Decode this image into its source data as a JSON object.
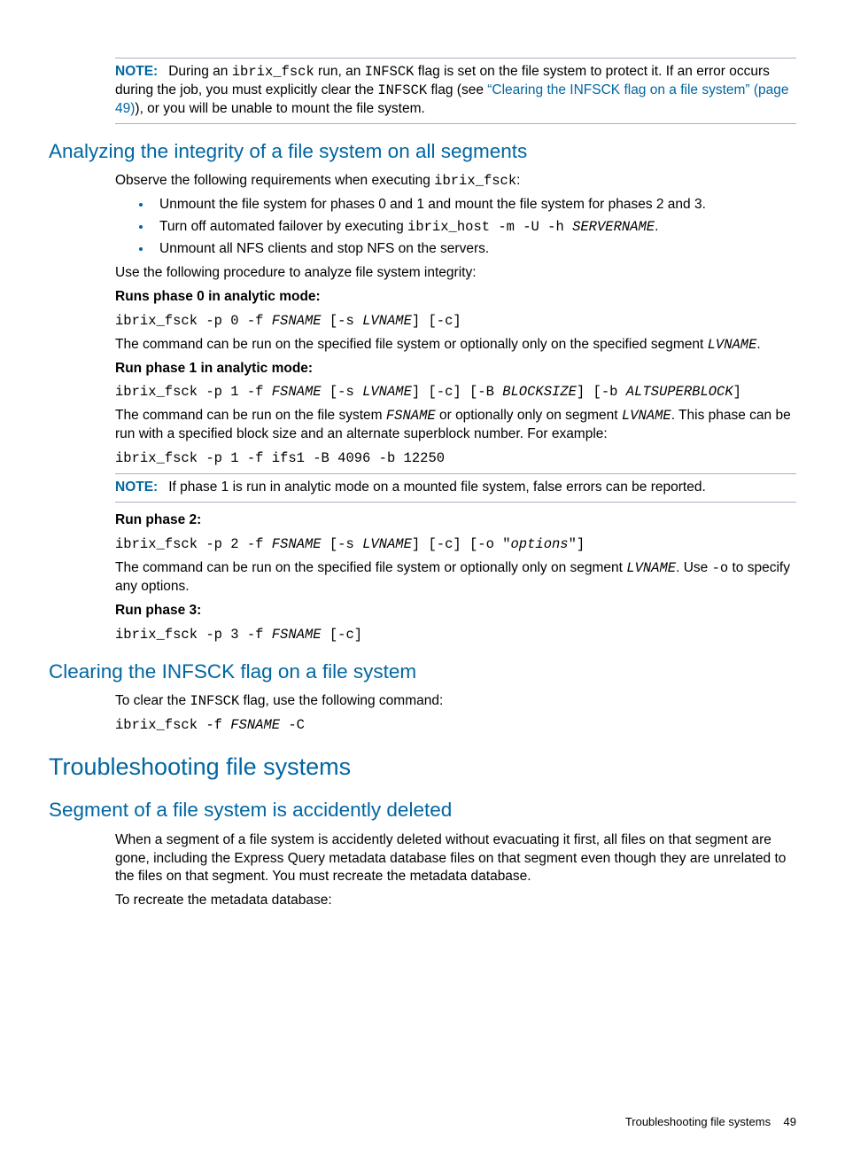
{
  "note1": {
    "label": "NOTE:",
    "t1": "During an ",
    "c1": "ibrix_fsck",
    "t2": " run, an ",
    "c2": "INFSCK",
    "t3": " flag is set on the file system to protect it. If an error occurs during the job, you must explicitly clear the ",
    "c3": "INFSCK",
    "t4": " flag (see ",
    "link": "“Clearing the INFSCK flag on a file system” (page 49)",
    "t5": "), or you will be unable to mount the file system."
  },
  "h2_analyze": "Analyzing the integrity of a file system on all segments",
  "analyze_intro_t1": "Observe the following requirements when executing ",
  "analyze_intro_c1": "ibrix_fsck",
  "analyze_intro_t2": ":",
  "bullets": {
    "b1": "Unmount the file system for phases 0 and 1 and mount the file system for phases 2 and 3.",
    "b2_t1": "Turn off automated failover by executing ",
    "b2_c1": "ibrix_host -m -U -h ",
    "b2_ci1": "SERVERNAME",
    "b2_t2": ".",
    "b3": "Unmount all NFS clients and stop NFS on the servers."
  },
  "useproc": "Use the following procedure to analyze file system integrity:",
  "p0": {
    "h": "Runs phase 0 in analytic mode:",
    "c_t1": "ibrix_fsck -p 0 -f ",
    "c_i1": "FSNAME",
    "c_t2": " [-s ",
    "c_i2": "LVNAME",
    "c_t3": "] [-c]",
    "d_t1": "The command can be run on the specified file system or optionally only on the specified segment ",
    "d_ci1": "LVNAME",
    "d_t2": "."
  },
  "p1": {
    "h": "Run phase 1 in analytic mode:",
    "c_t1": "ibrix_fsck -p 1 -f ",
    "c_i1": "FSNAME",
    "c_t2": " [-s ",
    "c_i2": "LVNAME",
    "c_t3": "] [-c] [-B ",
    "c_i3": "BLOCKSIZE",
    "c_t4": "] [-b ",
    "c_i4": "ALTSUPERBLOCK",
    "c_t5": "]",
    "d_t1": "The command can be run on the file system ",
    "d_ci1": "FSNAME",
    "d_t2": " or optionally only on segment ",
    "d_ci2": "LVNAME",
    "d_t3": ". This phase can be run with a specified block size and an alternate superblock number. For example:",
    "ex": "ibrix_fsck -p 1 -f ifs1 -B 4096 -b 12250"
  },
  "note2": {
    "label": "NOTE:",
    "t": "If phase 1 is run in analytic mode on a mounted file system, false errors can be reported."
  },
  "p2": {
    "h": "Run phase 2:",
    "c_t1": "ibrix_fsck -p 2 -f ",
    "c_i1": "FSNAME",
    "c_t2": " [-s ",
    "c_i2": "LVNAME",
    "c_t3": "] [-c] [-o \"",
    "c_i3": "options",
    "c_t4": "\"]",
    "d_t1": "The command can be run on the specified file system or optionally only on segment ",
    "d_ci1": "LVNAME",
    "d_t2": ". Use ",
    "d_c2": "-o",
    "d_t3": " to specify any options."
  },
  "p3": {
    "h": "Run phase 3:",
    "c_t1": "ibrix_fsck -p 3 -f ",
    "c_i1": "FSNAME",
    "c_t2": " [-c]"
  },
  "h2_clear": "Clearing the INFSCK flag on a file system",
  "clear_t1": "To clear the ",
  "clear_c1": "INFSCK",
  "clear_t2": " flag, use the following command:",
  "clear_cmd_t1": "ibrix_fsck -f ",
  "clear_cmd_i1": "FSNAME",
  "clear_cmd_t2": " -C",
  "h1_trouble": "Troubleshooting file systems",
  "h2_seg": "Segment of a file system is accidently deleted",
  "seg_p1": "When a segment of a file system is accidently deleted without evacuating it first, all files on that segment are gone, including the Express Query metadata database files on that segment even though they are unrelated to the files on that segment. You must recreate the metadata database.",
  "seg_p2": "To recreate the metadata database:",
  "footer_text": "Troubleshooting file systems",
  "footer_page": "49"
}
